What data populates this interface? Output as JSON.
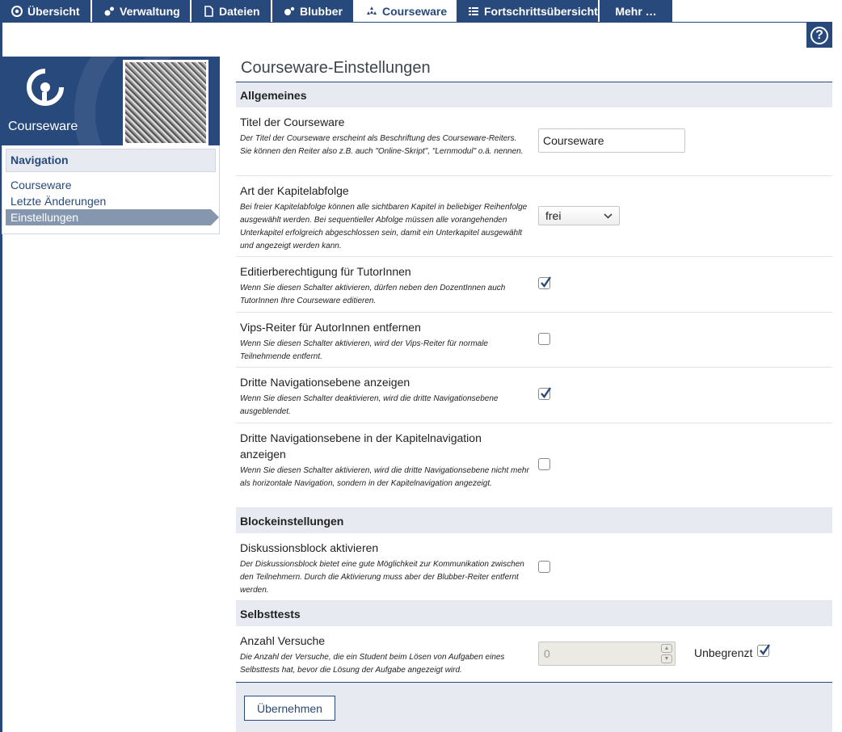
{
  "tabs": [
    {
      "label": "Übersicht",
      "icon": "courseware-icon"
    },
    {
      "label": "Verwaltung",
      "icon": "admin-icon"
    },
    {
      "label": "Dateien",
      "icon": "files-icon"
    },
    {
      "label": "Blubber",
      "icon": "blubber-icon"
    },
    {
      "label": "Courseware",
      "icon": "courseware-tab-icon",
      "active": true
    },
    {
      "label": "Fortschrittsübersicht",
      "icon": "progress-icon"
    },
    {
      "label": "Mehr …",
      "icon": ""
    }
  ],
  "help": {
    "label": "?"
  },
  "sidebar": {
    "title": "Courseware",
    "nav_title": "Navigation",
    "items": [
      {
        "label": "Courseware"
      },
      {
        "label": "Letzte Änderungen"
      },
      {
        "label": "Einstellungen",
        "active": true
      }
    ]
  },
  "main": {
    "title": "Courseware-Einstellungen",
    "sections": {
      "general": "Allgemeines",
      "blocks": "Blockeinstellungen",
      "selftests": "Selbsttests"
    },
    "settings": {
      "title": {
        "label": "Titel der Courseware",
        "desc": "Der Titel der Courseware erscheint als Beschriftung des Courseware-Reiters. Sie können den Reiter also z.B. auch \"Online-Skript\", \"Lernmodul\" o.ä. nennen.",
        "value": "Courseware"
      },
      "sequence": {
        "label": "Art der Kapitelabfolge",
        "desc": "Bei freier Kapitelabfolge können alle sichtbaren Kapitel in beliebiger Reihenfolge ausgewählt werden. Bei sequentieller Abfolge müssen alle vorangehenden Unterkapitel erfolgreich abgeschlossen sein, damit ein Unterkapitel ausgewählt und angezeigt werden kann.",
        "value": "frei"
      },
      "tutor_edit": {
        "label": "Editierberechtigung für TutorInnen",
        "desc": "Wenn Sie diesen Schalter aktivieren, dürfen neben den DozentInnen auch TutorInnen Ihre Courseware editieren.",
        "checked": true
      },
      "vips": {
        "label": "Vips-Reiter für AutorInnen entfernen",
        "desc": "Wenn Sie diesen Schalter aktivieren, wird der Vips-Reiter für normale Teilnehmende entfernt.",
        "checked": false
      },
      "third_nav": {
        "label": "Dritte Navigationsebene anzeigen",
        "desc": "Wenn Sie diesen Schalter deaktivieren, wird die dritte Navigationsebene ausgeblendet.",
        "checked": true
      },
      "third_nav_chapter": {
        "label": "Dritte Navigationsebene in der Kapitelnavigation anzeigen",
        "desc": "Wenn Sie diesen Schalter aktivieren, wird die dritte Navigationsebene nicht mehr als horizontale Navigation, sondern in der Kapitelnavigation angezeigt.",
        "checked": false
      },
      "discussion": {
        "label": "Diskussionsblock aktivieren",
        "desc": "Der Diskussionsblock bietet eine gute Möglichkeit zur Kommunikation zwischen den Teilnehmern. Durch die Aktivierung muss aber der Blubber-Reiter entfernt werden.",
        "checked": false
      },
      "attempts": {
        "label": "Anzahl Versuche",
        "desc": "Die Anzahl der Versuche, die ein Student beim Lösen von Aufgaben eines Selbsttests hat, bevor die Lösung der Aufgabe angezeigt wird.",
        "value": "0",
        "unlimited_label": "Unbegrenzt",
        "unlimited_checked": true
      }
    },
    "submit_label": "Übernehmen"
  },
  "colors": {
    "brand": "#28497c",
    "section_bg": "#e7ebf1",
    "nav_active": "#8596af"
  }
}
